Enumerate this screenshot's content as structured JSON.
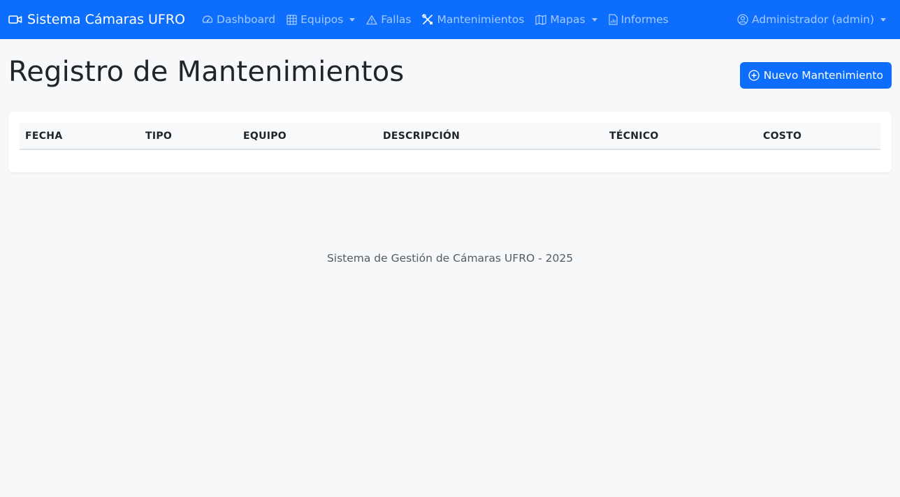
{
  "navbar": {
    "brand": "Sistema Cámaras UFRO",
    "brand_icon": "camera-video-icon",
    "items": [
      {
        "label": "Dashboard",
        "icon": "speedometer-icon"
      },
      {
        "label": "Equipos",
        "icon": "grid-icon",
        "dropdown": true
      },
      {
        "label": "Fallas",
        "icon": "warning-icon"
      },
      {
        "label": "Mantenimientos",
        "icon": "tools-icon"
      },
      {
        "label": "Mapas",
        "icon": "map-icon",
        "dropdown": true
      },
      {
        "label": "Informes",
        "icon": "report-icon"
      }
    ],
    "user": {
      "label": "Administrador (admin)",
      "icon": "user-circle-icon",
      "dropdown": true
    },
    "colors": {
      "background": "#0d6efd",
      "text": "#ffffff"
    }
  },
  "main": {
    "title": "Registro de Mantenimientos",
    "new_button": {
      "label": "Nuevo Mantenimiento",
      "icon": "plus-circle-icon"
    },
    "table": {
      "columns": [
        "FECHA",
        "TIPO",
        "EQUIPO",
        "DESCRIPCIÓN",
        "TÉCNICO",
        "COSTO"
      ],
      "rows": []
    }
  },
  "footer": {
    "text": "Sistema de Gestión de Cámaras UFRO - 2025"
  }
}
